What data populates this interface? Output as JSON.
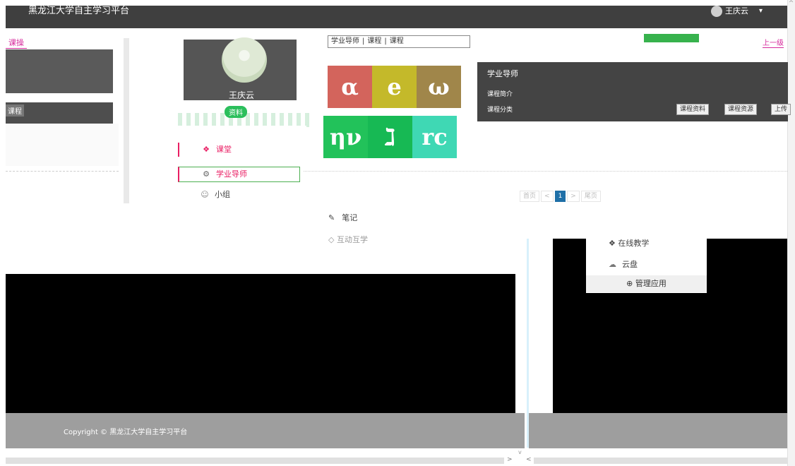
{
  "topbar": {
    "brand": "黑龙江大学自主学习平台",
    "user_name": "王庆云",
    "caret": "▾"
  },
  "left": {
    "tab_label": "课操",
    "chip_label": "课程"
  },
  "profile": {
    "name": "王庆云",
    "badge": "资料"
  },
  "menu": {
    "items": [
      {
        "label": "课堂",
        "icon": "diamond-icon"
      },
      {
        "label": "学业导师",
        "icon": "mentor-icon"
      },
      {
        "label": "小组",
        "icon": "group-icon"
      }
    ]
  },
  "notes": {
    "label": "笔记",
    "label2": "互动互学"
  },
  "course": {
    "tabs": [
      "学业导师",
      "课程",
      "课程"
    ],
    "right_link": "上一级",
    "title": "学业导师",
    "line1": "课程简介",
    "line2": "课程分类",
    "buttons": [
      "课程资料",
      "课程资源",
      "上传"
    ],
    "tiles": [
      "α",
      "e",
      "ω",
      "ην",
      "ℷ",
      "rc"
    ]
  },
  "pager": {
    "prev_first": "首页",
    "prev": "<",
    "current": "1",
    "next": ">",
    "last": "尾页"
  },
  "apps": {
    "item1": "在线教学",
    "cloud": "云盘",
    "manage": "管理应用"
  },
  "footer": {
    "copyright": "Copyright © 黑龙江大学自主学习平台"
  },
  "colors": {
    "accent": "#e91e63",
    "green": "#2bbf5c",
    "topbar": "#3f3f3f",
    "footer": "#9e9e9e",
    "pager_active": "#1e6fa7"
  }
}
